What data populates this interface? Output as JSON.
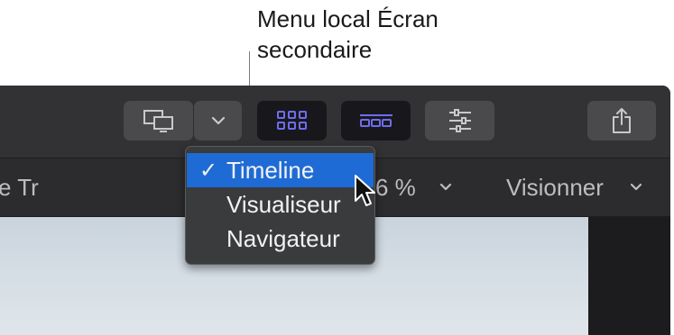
{
  "callout": {
    "line1": "Menu local Écran",
    "line2": "secondaire"
  },
  "toolbar": {
    "buttons": [
      {
        "name": "display-toggle",
        "icon": "second-display-icon"
      },
      {
        "name": "display-dropdown",
        "icon": "chevron-down-icon"
      },
      {
        "name": "browser-layout",
        "icon": "grid-icon",
        "accent": "#6f6cf0"
      },
      {
        "name": "timeline-layout",
        "icon": "timeline-icon",
        "accent": "#6f6cf0"
      },
      {
        "name": "inspector",
        "icon": "sliders-icon"
      },
      {
        "name": "share",
        "icon": "share-icon"
      }
    ]
  },
  "subbar": {
    "left_text": "e Tr",
    "zoom_text": "6 %",
    "view_menu_label": "Visionner"
  },
  "menu": {
    "items": [
      {
        "label": "Timeline",
        "selected": true,
        "check": "✓"
      },
      {
        "label": "Visualiseur",
        "selected": false
      },
      {
        "label": "Navigateur",
        "selected": false
      }
    ]
  },
  "colors": {
    "accent_blue": "#1f6bd6",
    "toolbar_accent": "#6f6cf0"
  }
}
